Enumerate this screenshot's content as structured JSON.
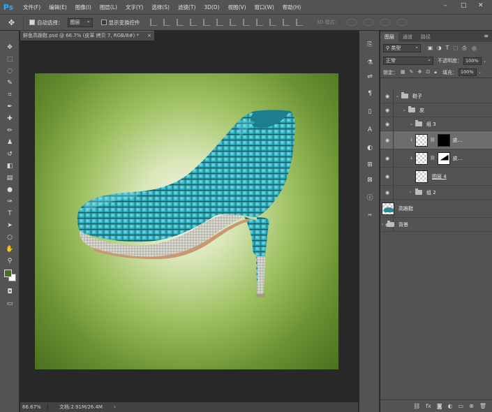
{
  "app": {
    "logo": "Ps",
    "menu": [
      "文件(F)",
      "编辑(E)",
      "图像(I)",
      "图层(L)",
      "文字(Y)",
      "选择(S)",
      "滤镜(T)",
      "3D(D)",
      "视图(V)",
      "窗口(W)",
      "帮助(H)"
    ],
    "window_controls": [
      "–",
      "□",
      "✕"
    ]
  },
  "options": {
    "move_icon": "move-tool-icon",
    "auto_select_label": "自动选择：",
    "auto_select_value": "图层",
    "show_transform_label": "显示变换控件",
    "mode_3d_label": "3D 模式："
  },
  "document": {
    "tab_title": "鲜鱼高跟鞋.psd @ 66.7% (皮革 拷贝 7, RGB/8#) *",
    "close": "×"
  },
  "status": {
    "zoom": "66.67%",
    "doc_info": "文档:2.91M/26.4M",
    "arrow": "›"
  },
  "colors": {
    "foreground": "#4c6d22",
    "background": "#ffffff",
    "accent": "#31a8ff"
  },
  "panel": {
    "tabs": [
      "图层",
      "通道",
      "路径"
    ],
    "filter_kind": "类型",
    "blend_mode": "正常",
    "opacity_label": "不透明度：",
    "opacity_value": "100%",
    "lock_label": "锁定：",
    "fill_label": "填充：",
    "fill_value": "100%",
    "layers": [
      {
        "name": "鞋子",
        "type": "group",
        "indent": 0,
        "expanded": true
      },
      {
        "name": "皮",
        "type": "group",
        "indent": 1,
        "expanded": true
      },
      {
        "name": "组 3",
        "type": "group",
        "indent": 2,
        "expanded": true
      },
      {
        "name": "皮...",
        "type": "masked",
        "indent": 3,
        "selected": true,
        "mask": "black"
      },
      {
        "name": "皮...",
        "type": "masked",
        "indent": 3,
        "selected": false,
        "mask": "white"
      },
      {
        "name": "图层 4",
        "type": "layer",
        "indent": 3
      },
      {
        "name": "组 2",
        "type": "group",
        "indent": 2,
        "expanded": false
      },
      {
        "name": "高跟鞋",
        "type": "layer",
        "indent": 0,
        "shoe": true
      },
      {
        "name": "背景",
        "type": "group",
        "indent": 0,
        "expanded": false
      }
    ]
  }
}
